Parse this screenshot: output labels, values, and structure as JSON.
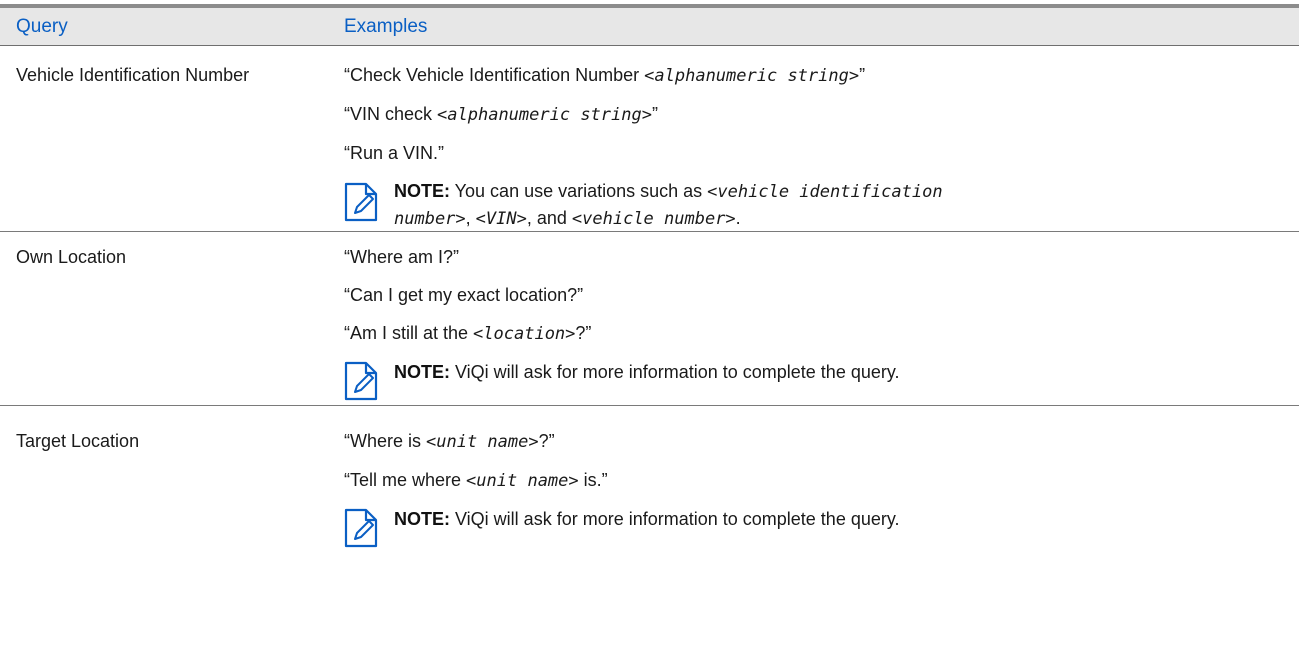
{
  "header": {
    "query": "Query",
    "examples": "Examples"
  },
  "rows": [
    {
      "query": "Vehicle Identification Number",
      "examples": [
        {
          "pre": "“Check Vehicle Identification Number ",
          "mono": "<alphanumeric string>",
          "post": "”"
        },
        {
          "pre": "“VIN check ",
          "mono": "<alphanumeric string>",
          "post": "”"
        },
        {
          "pre": "“Run a VIN.”",
          "mono": "",
          "post": ""
        }
      ],
      "note": {
        "label": "NOTE:",
        "line1_text": " You can use variations such as ",
        "line1_mono": "<vehicle identification",
        "line2_mono_a": "number>",
        "line2_sep1": ", ",
        "line2_mono_b": "<VIN>",
        "line2_sep2": ", and ",
        "line2_mono_c": "<vehicle number>",
        "line2_end": "."
      }
    },
    {
      "query": "Own Location",
      "examples": [
        {
          "pre": "“Where am I?”",
          "mono": "",
          "post": ""
        },
        {
          "pre": "“Can I get my exact location?”",
          "mono": "",
          "post": ""
        },
        {
          "pre": "“Am I still at the ",
          "mono": "<location>",
          "post": "?”"
        }
      ],
      "note": {
        "label": "NOTE:",
        "text": " ViQi will ask for more information to complete the query."
      }
    },
    {
      "query": "Target Location",
      "examples": [
        {
          "pre": "“Where is ",
          "mono": "<unit name>",
          "post": "?”"
        },
        {
          "pre": "“Tell me where ",
          "mono": "<unit name>",
          "post": " is.”"
        }
      ],
      "note": {
        "label": "NOTE:",
        "text": " ViQi will ask for more information to complete the query."
      }
    }
  ]
}
